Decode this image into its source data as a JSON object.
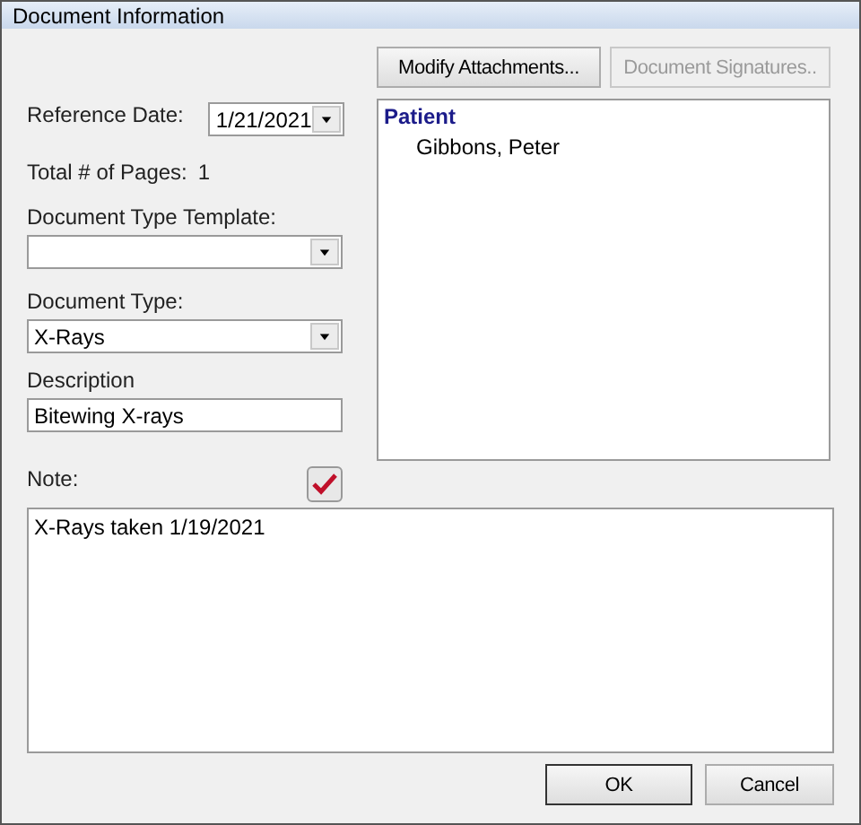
{
  "window": {
    "title": "Document Information"
  },
  "buttons_top": [
    {
      "label": "Modify Attachments...",
      "disabled": false
    },
    {
      "label": "Document Signatures..",
      "disabled": true
    }
  ],
  "reference_date": {
    "label": "Reference Date:",
    "value": "1/21/2021"
  },
  "total_pages": {
    "label": "Total # of Pages:",
    "value": "1"
  },
  "document_type_template": {
    "label": "Document Type Template:"
  },
  "document_type": {
    "label": "Document Type:",
    "value": "X-Rays"
  },
  "description": {
    "label": "Description",
    "value": "Bitewing X-rays"
  },
  "note": {
    "label": "Note:",
    "value": "X-Rays taken 1/19/2021"
  },
  "attachments": {
    "heading": "Patient",
    "items": [
      "Gibbons, Peter"
    ]
  },
  "buttons_bottom": [
    {
      "label": "OK",
      "default": true
    },
    {
      "label": "Cancel",
      "default": false
    }
  ]
}
